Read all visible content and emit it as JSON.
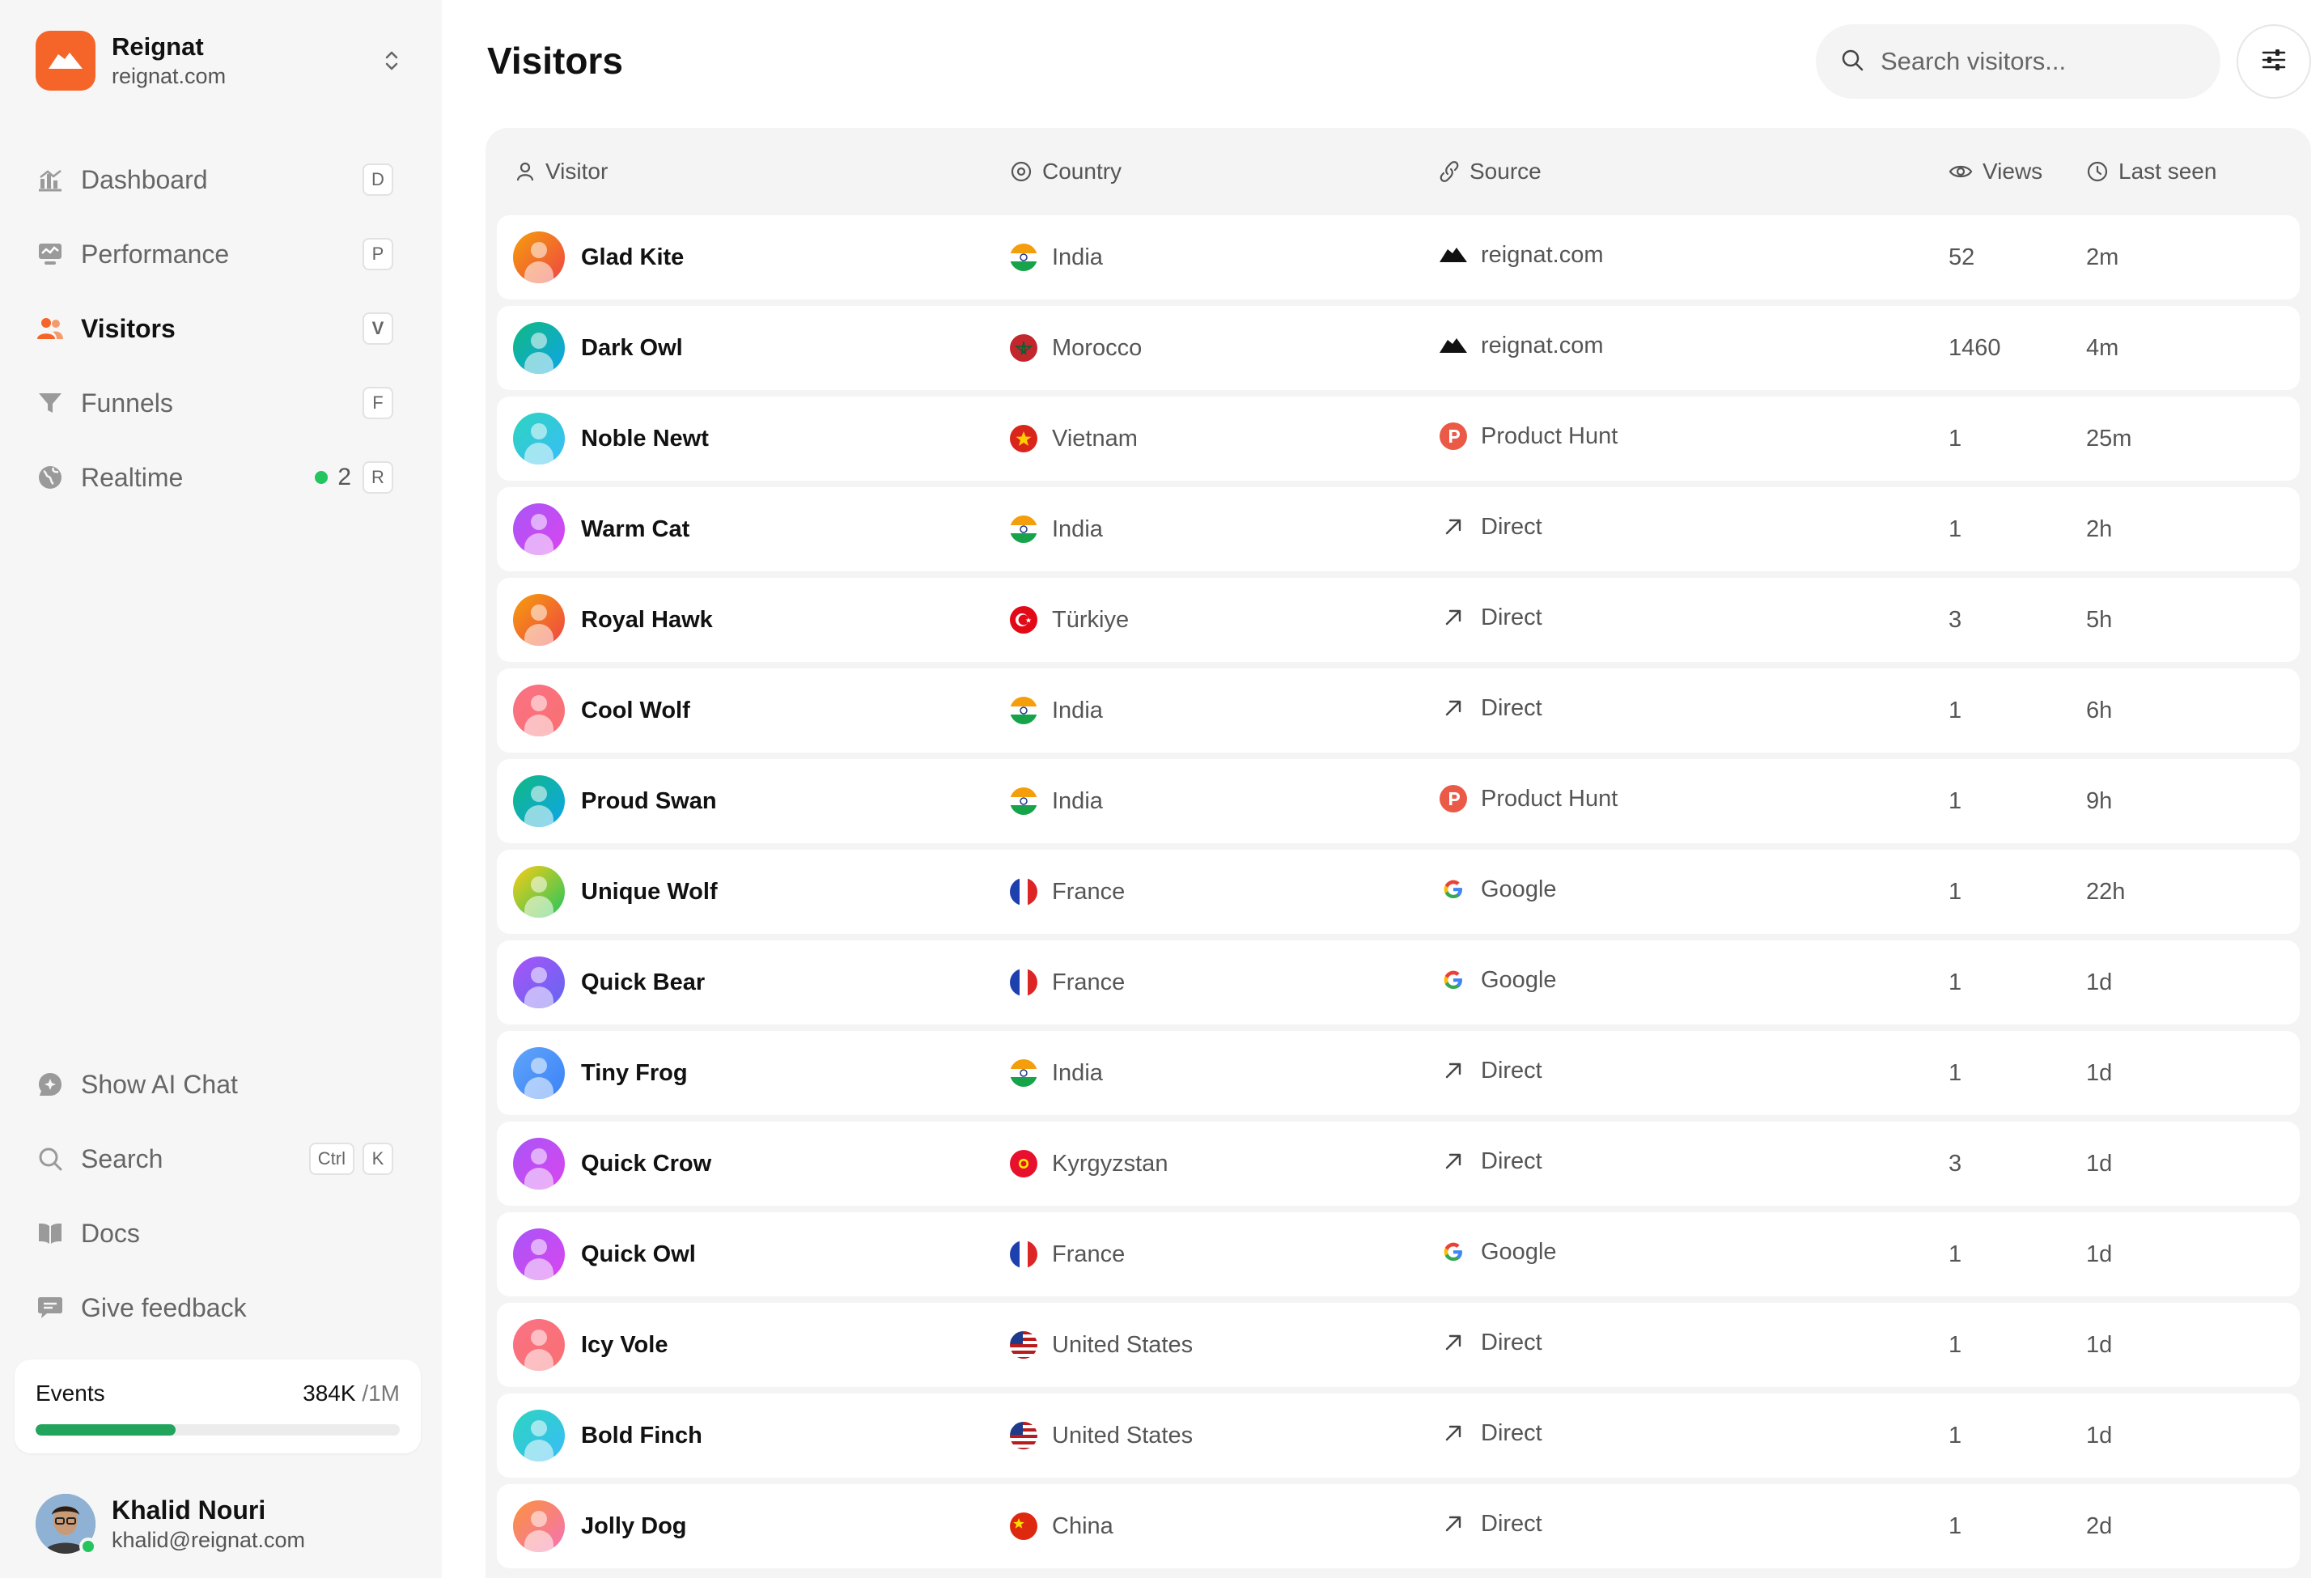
{
  "brand": {
    "name": "Reignat",
    "domain": "reignat.com",
    "accent": "#f5652a"
  },
  "nav": [
    {
      "label": "Dashboard",
      "key": "D",
      "icon": "bar-chart-icon",
      "active": false
    },
    {
      "label": "Performance",
      "key": "P",
      "icon": "monitor-icon",
      "active": false
    },
    {
      "label": "Visitors",
      "key": "V",
      "icon": "users-icon",
      "active": true
    },
    {
      "label": "Funnels",
      "key": "F",
      "icon": "funnel-icon",
      "active": false
    },
    {
      "label": "Realtime",
      "key": "R",
      "icon": "globe-icon",
      "active": false,
      "live_count": "2"
    }
  ],
  "bottom_nav": {
    "ai_chat": "Show AI Chat",
    "search": "Search",
    "search_keys": [
      "Ctrl",
      "K"
    ],
    "docs": "Docs",
    "feedback": "Give feedback"
  },
  "events": {
    "label": "Events",
    "used": "384K",
    "limit": "/1M",
    "progress": 0.384
  },
  "user": {
    "name": "Khalid Nouri",
    "email": "khalid@reignat.com"
  },
  "page": {
    "title": "Visitors"
  },
  "search": {
    "placeholder": "Search visitors..."
  },
  "columns": {
    "visitor": "Visitor",
    "country": "Country",
    "source": "Source",
    "views": "Views",
    "last_seen": "Last seen"
  },
  "rows": [
    {
      "name": "Glad Kite",
      "avatar": [
        "#f59e0b",
        "#ef4444"
      ],
      "country": "India",
      "flag": "in",
      "source": "reignat.com",
      "source_icon": "reignat",
      "views": "52",
      "last_seen": "2m"
    },
    {
      "name": "Dark Owl",
      "avatar": [
        "#10b981",
        "#0ea5e9"
      ],
      "country": "Morocco",
      "flag": "ma",
      "source": "reignat.com",
      "source_icon": "reignat",
      "views": "1460",
      "last_seen": "4m"
    },
    {
      "name": "Noble Newt",
      "avatar": [
        "#2dd4bf",
        "#38bdf8"
      ],
      "country": "Vietnam",
      "flag": "vn",
      "source": "Product Hunt",
      "source_icon": "producthunt",
      "views": "1",
      "last_seen": "25m"
    },
    {
      "name": "Warm Cat",
      "avatar": [
        "#a855f7",
        "#d946ef"
      ],
      "country": "India",
      "flag": "in",
      "source": "Direct",
      "source_icon": "direct",
      "views": "1",
      "last_seen": "2h"
    },
    {
      "name": "Royal Hawk",
      "avatar": [
        "#f59e0b",
        "#ef4444"
      ],
      "country": "Türkiye",
      "flag": "tr",
      "source": "Direct",
      "source_icon": "direct",
      "views": "3",
      "last_seen": "5h"
    },
    {
      "name": "Cool Wolf",
      "avatar": [
        "#fb7185",
        "#f87171"
      ],
      "country": "India",
      "flag": "in",
      "source": "Direct",
      "source_icon": "direct",
      "views": "1",
      "last_seen": "6h"
    },
    {
      "name": "Proud Swan",
      "avatar": [
        "#10b981",
        "#0ea5e9"
      ],
      "country": "India",
      "flag": "in",
      "source": "Product Hunt",
      "source_icon": "producthunt",
      "views": "1",
      "last_seen": "9h"
    },
    {
      "name": "Unique Wolf",
      "avatar": [
        "#facc15",
        "#22c55e"
      ],
      "country": "France",
      "flag": "fr",
      "source": "Google",
      "source_icon": "google",
      "views": "1",
      "last_seen": "22h"
    },
    {
      "name": "Quick Bear",
      "avatar": [
        "#a855f7",
        "#6366f1"
      ],
      "country": "France",
      "flag": "fr",
      "source": "Google",
      "source_icon": "google",
      "views": "1",
      "last_seen": "1d"
    },
    {
      "name": "Tiny Frog",
      "avatar": [
        "#60a5fa",
        "#3b82f6"
      ],
      "country": "India",
      "flag": "in",
      "source": "Direct",
      "source_icon": "direct",
      "views": "1",
      "last_seen": "1d"
    },
    {
      "name": "Quick Crow",
      "avatar": [
        "#a855f7",
        "#d946ef"
      ],
      "country": "Kyrgyzstan",
      "flag": "kg",
      "source": "Direct",
      "source_icon": "direct",
      "views": "3",
      "last_seen": "1d"
    },
    {
      "name": "Quick Owl",
      "avatar": [
        "#a855f7",
        "#d946ef"
      ],
      "country": "France",
      "flag": "fr",
      "source": "Google",
      "source_icon": "google",
      "views": "1",
      "last_seen": "1d"
    },
    {
      "name": "Icy Vole",
      "avatar": [
        "#fb7185",
        "#f87171"
      ],
      "country": "United States",
      "flag": "us",
      "source": "Direct",
      "source_icon": "direct",
      "views": "1",
      "last_seen": "1d"
    },
    {
      "name": "Bold Finch",
      "avatar": [
        "#2dd4bf",
        "#38bdf8"
      ],
      "country": "United States",
      "flag": "us",
      "source": "Direct",
      "source_icon": "direct",
      "views": "1",
      "last_seen": "1d"
    },
    {
      "name": "Jolly Dog",
      "avatar": [
        "#fb923c",
        "#f472b6"
      ],
      "country": "China",
      "flag": "cn",
      "source": "Direct",
      "source_icon": "direct",
      "views": "1",
      "last_seen": "2d"
    }
  ]
}
